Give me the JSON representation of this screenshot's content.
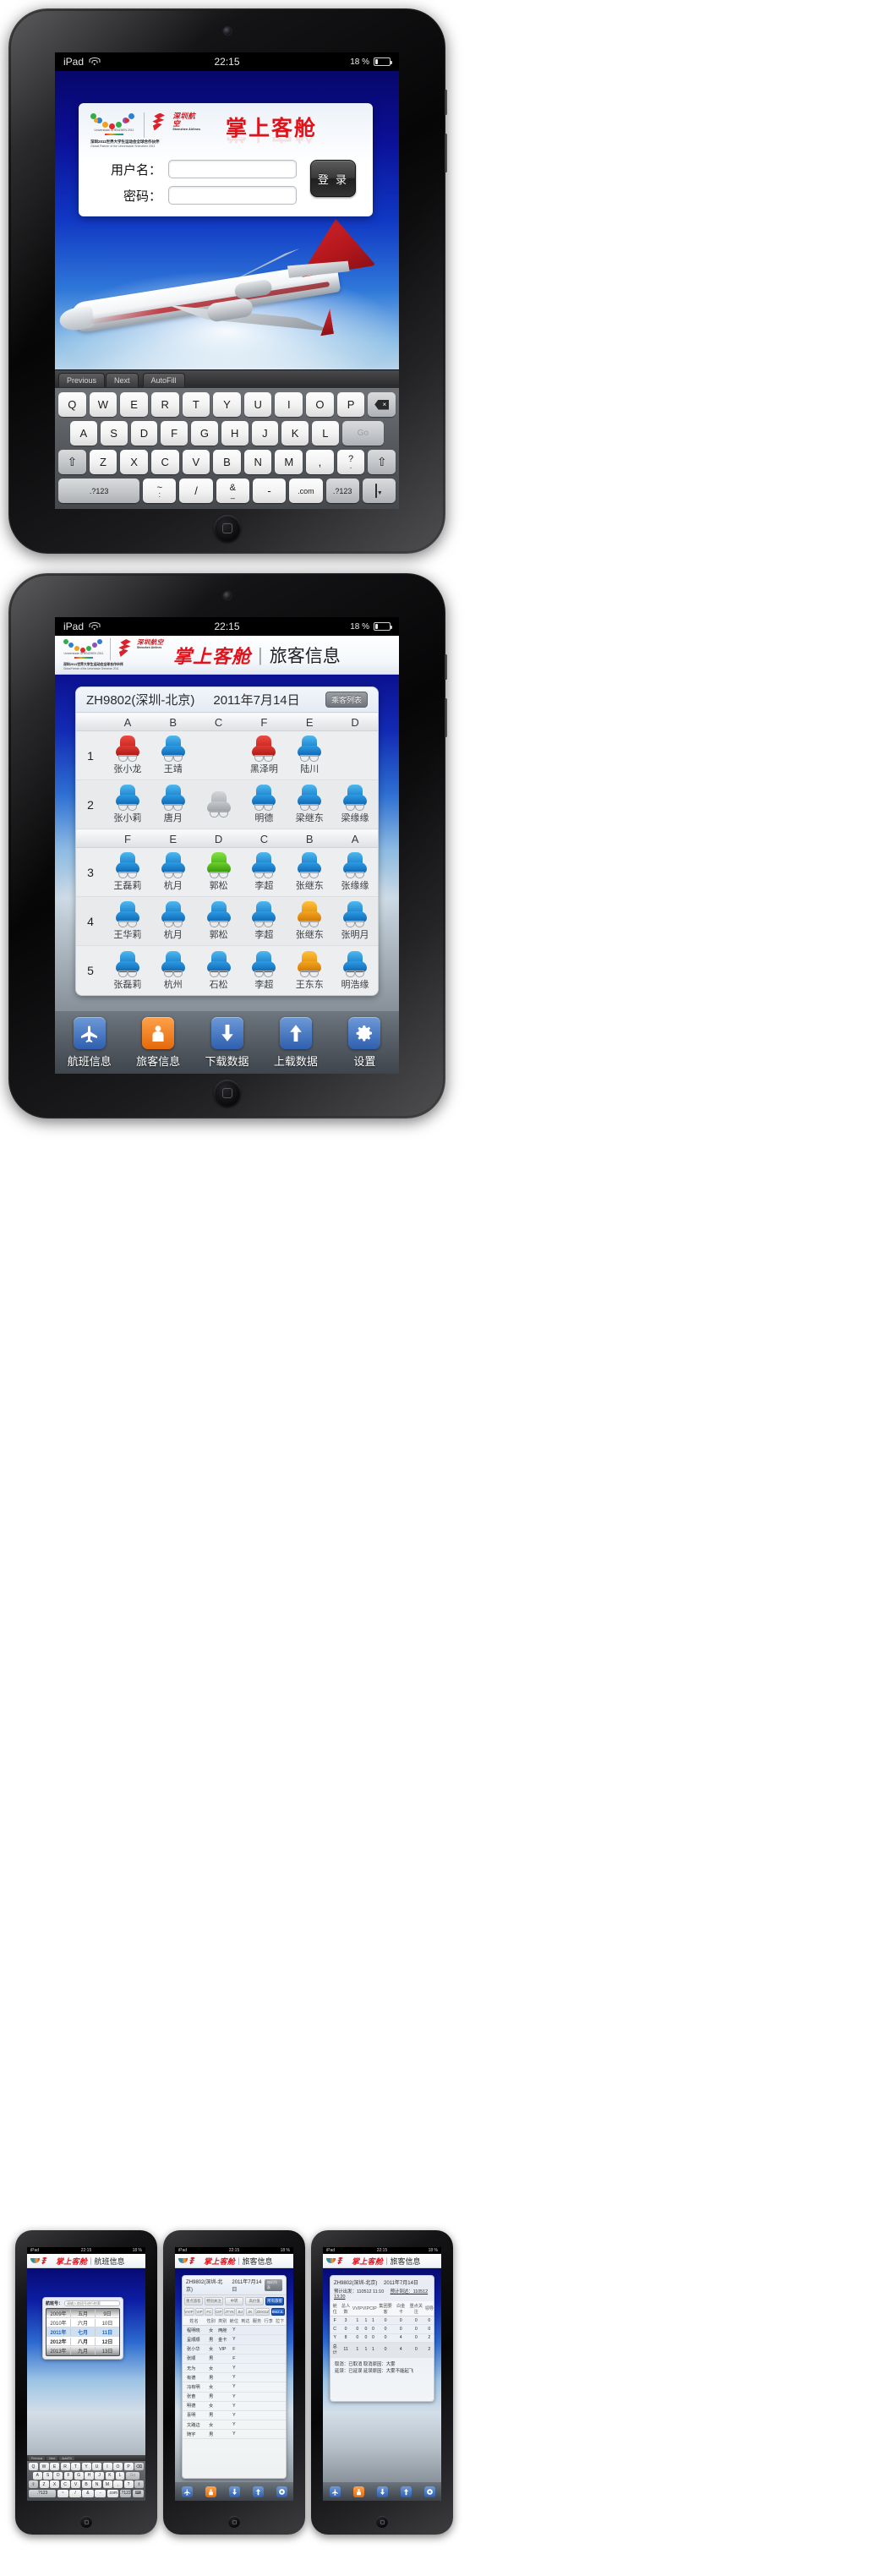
{
  "status_bar": {
    "carrier": "iPad",
    "time": "22:15",
    "battery": "18 %",
    "wifi_icon": "wifi-icon",
    "battery_icon": "battery-icon"
  },
  "brand": {
    "app_name": "掌上客舱",
    "airline_cn": "深圳航空",
    "airline_en": "Shenzhen Airlines",
    "partner_cn": "深圳2011世界大学生运动会全球合作伙伴",
    "partner_en": "Global Partner of the Universiade Shenzhen 2011",
    "universiade_label": "Universiade SHENZHEN 2011",
    "brand_red": "#e3121a"
  },
  "login": {
    "username_label": "用户名：",
    "password_label": "密码：",
    "username_value": "",
    "password_value": "",
    "username_placeholder": "",
    "password_placeholder": "",
    "login_button": "登 录"
  },
  "keyboard": {
    "form_bar": [
      "Previous",
      "Next",
      "AutoFill"
    ],
    "row1": [
      "Q",
      "W",
      "E",
      "R",
      "T",
      "Y",
      "U",
      "I",
      "O",
      "P"
    ],
    "row1_end": "backspace-icon",
    "row2": [
      "A",
      "S",
      "D",
      "F",
      "G",
      "H",
      "J",
      "K",
      "L"
    ],
    "row2_end": "Go",
    "row3_start": "shift-icon",
    "row3": [
      "Z",
      "X",
      "C",
      "V",
      "B",
      "N",
      "M",
      ","
    ],
    "row3_punct_top": "?",
    "row3_punct_bottom": ".",
    "row3_end": "shift-icon",
    "row4": [
      ".?123",
      "~ :",
      "/",
      "& _",
      "-",
      ".com",
      ".?123"
    ],
    "row4_tilde_top": "~",
    "row4_tilde_bottom": ":",
    "row4_amp_top": "&",
    "row4_amp_bottom": "_",
    "row4_end": "hide-keyboard-icon"
  },
  "seatmap_screen": {
    "header_title": "掌上客舱",
    "header_separator": "|",
    "header_subtitle": "旅客信息",
    "flight_no": "ZH9802(深圳-北京)",
    "flight_date": "2011年7月14日",
    "pax_list_button": "乘客列表",
    "columns_top": [
      "A",
      "B",
      "C",
      "F",
      "E",
      "D"
    ],
    "columns_bottom": [
      "F",
      "E",
      "D",
      "C",
      "B",
      "A"
    ],
    "rows": [
      {
        "number": "1",
        "seats": [
          {
            "name": "张小龙",
            "color": "red"
          },
          {
            "name": "王靖",
            "color": "blue"
          },
          {
            "name": "",
            "color": "none"
          },
          {
            "name": "黑泽明",
            "color": "red"
          },
          {
            "name": "陆川",
            "color": "blue"
          },
          {
            "name": "",
            "color": "none"
          }
        ]
      },
      {
        "number": "2",
        "seats": [
          {
            "name": "张小莉",
            "color": "blue"
          },
          {
            "name": "唐月",
            "color": "blue"
          },
          {
            "name": "",
            "color": "gray"
          },
          {
            "name": "明德",
            "color": "blue"
          },
          {
            "name": "梁继东",
            "color": "blue"
          },
          {
            "name": "梁缘缘",
            "color": "blue"
          }
        ]
      },
      {
        "number": "3",
        "seats": [
          {
            "name": "王磊莉",
            "color": "blue"
          },
          {
            "name": "杭月",
            "color": "blue"
          },
          {
            "name": "郭松",
            "color": "green"
          },
          {
            "name": "李超",
            "color": "blue"
          },
          {
            "name": "张继东",
            "color": "blue"
          },
          {
            "name": "张缘缘",
            "color": "blue"
          }
        ]
      },
      {
        "number": "4",
        "seats": [
          {
            "name": "王华莉",
            "color": "blue"
          },
          {
            "name": "杭月",
            "color": "blue"
          },
          {
            "name": "郭松",
            "color": "blue"
          },
          {
            "name": "李超",
            "color": "blue"
          },
          {
            "name": "张继东",
            "color": "orange"
          },
          {
            "name": "张明月",
            "color": "blue"
          }
        ]
      },
      {
        "number": "5",
        "seats": [
          {
            "name": "张磊莉",
            "color": "blue"
          },
          {
            "name": "杭州",
            "color": "blue"
          },
          {
            "name": "石松",
            "color": "blue"
          },
          {
            "name": "李超",
            "color": "blue"
          },
          {
            "name": "王东东",
            "color": "orange"
          },
          {
            "name": "明浩缘",
            "color": "blue"
          }
        ]
      }
    ],
    "seat_colors": {
      "red": "#d82b27",
      "blue": "#1a8fe0",
      "green": "#55c41e",
      "orange": "#ef9a11",
      "gray": "#b9bcbf"
    }
  },
  "tabbar": {
    "items": [
      {
        "label": "航班信息",
        "icon": "airplane-icon",
        "color": "#3f72c4",
        "active": false
      },
      {
        "label": "旅客信息",
        "icon": "person-icon",
        "color": "#f07c18",
        "active": true
      },
      {
        "label": "下载数据",
        "icon": "arrow-down-icon",
        "color": "#3f72c4",
        "active": false
      },
      {
        "label": "上载数据",
        "icon": "arrow-up-icon",
        "color": "#3f72c4",
        "active": false
      },
      {
        "label": "设置",
        "icon": "gear-icon",
        "color": "#3f72c4",
        "active": false
      }
    ]
  },
  "thumbnails": [
    {
      "title": "掌上客舱",
      "separator": "|",
      "subtitle": "航班信息",
      "search_label": "航班号：",
      "search_placeholder": "请输入航班号进行检索",
      "picker": {
        "years": [
          "2009年",
          "2010年",
          "2011年",
          "2012年",
          "2013年"
        ],
        "months": [
          "五月",
          "六月",
          "七月",
          "八月",
          "九月"
        ],
        "days": [
          "9日",
          "10日",
          "11日",
          "12日",
          "13日"
        ],
        "selected_year": "2011年",
        "selected_month": "七月",
        "selected_day": "11日"
      },
      "keyboard_rows": [
        [
          "Q",
          "W",
          "E",
          "R",
          "T",
          "Y",
          "U",
          "I",
          "O",
          "P",
          "⌫"
        ],
        [
          "A",
          "S",
          "D",
          "F",
          "G",
          "H",
          "J",
          "K",
          "L",
          "Go"
        ],
        [
          "⇧",
          "Z",
          "X",
          "C",
          "V",
          "B",
          "N",
          "M",
          ",",
          "?",
          "⇧"
        ],
        [
          ".?123",
          "~",
          "/",
          "&",
          "-",
          ".com",
          ".?123",
          "⌨"
        ]
      ]
    },
    {
      "title": "掌上客舱",
      "separator": "|",
      "subtitle": "旅客信息",
      "flight_no": "ZH9802(深圳-北京)",
      "flight_date": "2011年7月14日",
      "pax_list_button": "座机列表",
      "filters_top": [
        "重点旅客",
        "特别关注",
        "中转",
        "高价值",
        "所有旅客"
      ],
      "filters_top_active": "所有旅客",
      "filters_bottom": [
        "VVIP",
        "VIP",
        "FC",
        "CIP",
        "JTYK",
        "BJ",
        "JK",
        "ZDXGZ",
        "BMZJL"
      ],
      "filters_bottom_active": "BMZJL",
      "table_headers": [
        "姓名",
        "性别",
        "类别",
        "舱位",
        "到达",
        "服务",
        "行李",
        "拉下"
      ],
      "table_rows": [
        [
          "程明晓",
          "女",
          "两舱",
          "Y",
          "",
          "",
          "",
          ""
        ],
        [
          "呈顺顺",
          "男",
          "金卡",
          "Y",
          "",
          "",
          "",
          ""
        ],
        [
          "张小华",
          "女",
          "VIP",
          "F",
          "",
          "",
          "",
          ""
        ],
        [
          "张顺",
          "男",
          "",
          "F",
          "",
          "",
          "",
          ""
        ],
        [
          "无为",
          "女",
          "",
          "Y",
          "",
          "",
          "",
          ""
        ],
        [
          "有德",
          "男",
          "",
          "Y",
          "",
          "",
          "",
          ""
        ],
        [
          "冯有明",
          "女",
          "",
          "Y",
          "",
          "",
          "",
          ""
        ],
        [
          "张奋",
          "男",
          "",
          "Y",
          "",
          "",
          "",
          ""
        ],
        [
          "明德",
          "女",
          "",
          "Y",
          "",
          "",
          "",
          ""
        ],
        [
          "喜明",
          "男",
          "",
          "Y",
          "",
          "",
          "",
          ""
        ],
        [
          "文路边",
          "女",
          "",
          "Y",
          "",
          "",
          "",
          ""
        ],
        [
          "随宇",
          "男",
          "",
          "Y",
          "",
          "",
          "",
          ""
        ]
      ]
    },
    {
      "title": "掌上客舱",
      "separator": "|",
      "subtitle": "旅客信息",
      "flight_no": "ZH9802(深圳-北京)",
      "flight_date": "2011年7月14日",
      "departure_label": "预计出发：110512 11:10",
      "arrival_label": "预计到达：110512 13:20",
      "table_headers": [
        "舱位",
        "总人数",
        "VVIP",
        "VIP",
        "CIP",
        "集团要客",
        "白金卡",
        "重点关注",
        "领导"
      ],
      "table_rows": [
        [
          "F",
          "3",
          "1",
          "1",
          "1",
          "0",
          "0",
          "0",
          "0"
        ],
        [
          "C",
          "0",
          "0",
          "0",
          "0",
          "0",
          "0",
          "0",
          "0"
        ],
        [
          "Y",
          "8",
          "0",
          "0",
          "0",
          "0",
          "4",
          "0",
          "2"
        ],
        [
          "总计",
          "11",
          "1",
          "1",
          "1",
          "0",
          "4",
          "0",
          "2"
        ]
      ],
      "notes": [
        "取消：已取消    取消原因：大雾",
        "延误：已延误    延误原因：大雾不能起飞"
      ]
    }
  ]
}
